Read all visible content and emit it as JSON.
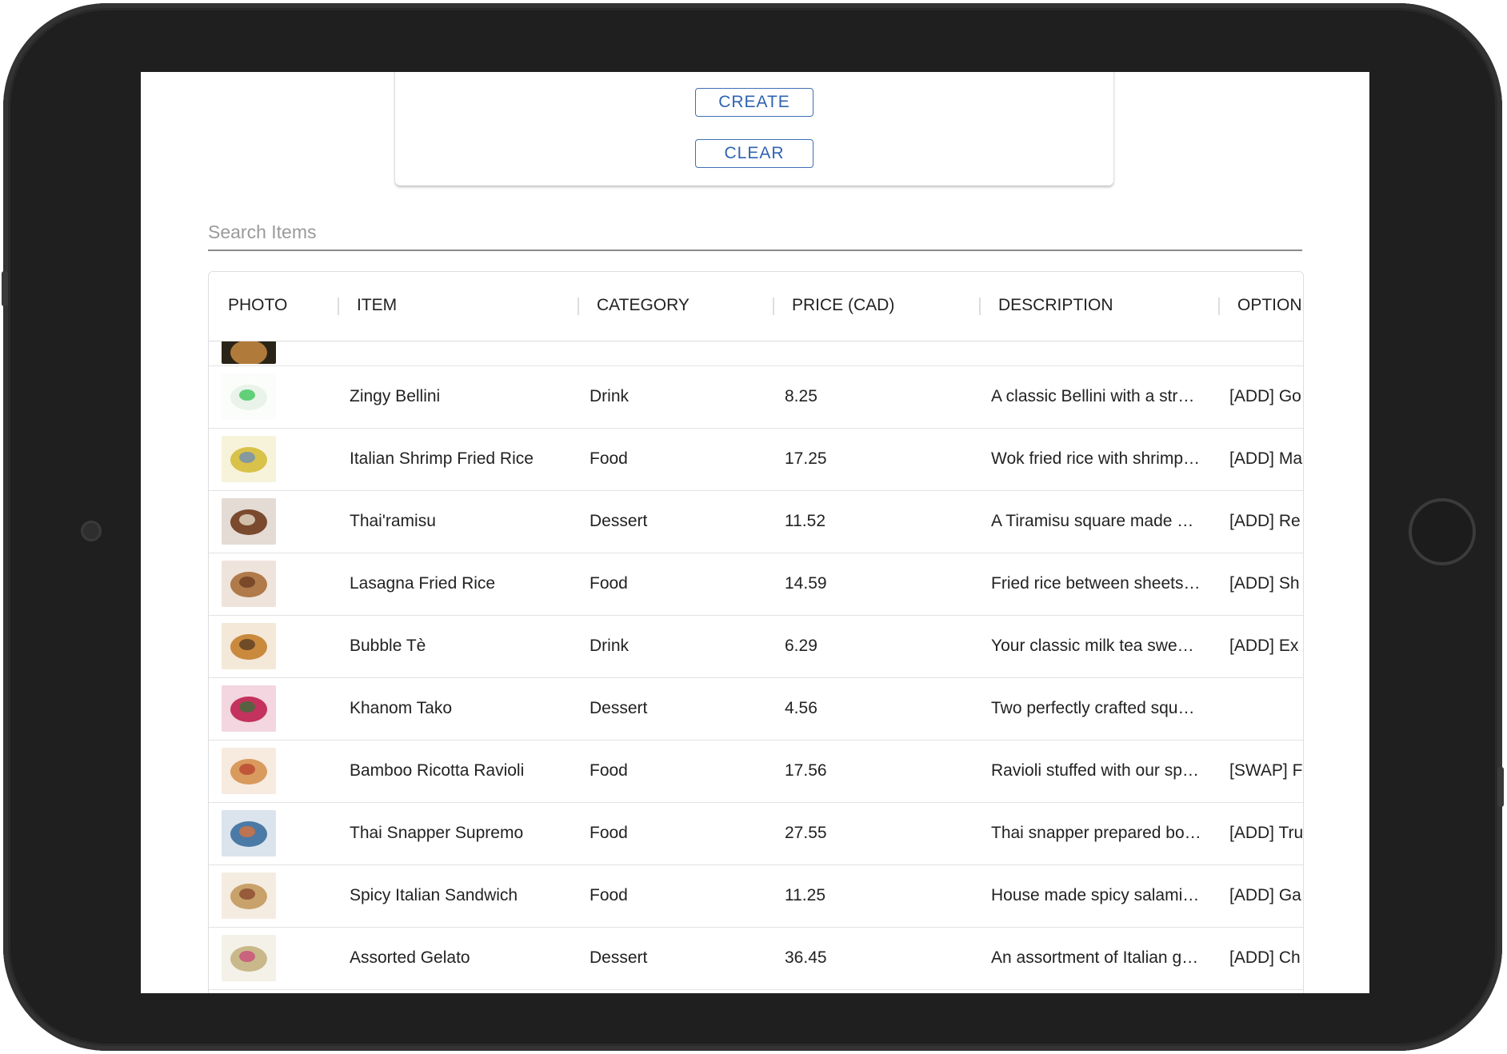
{
  "form": {
    "create_label": "CREATE",
    "clear_label": "CLEAR"
  },
  "search": {
    "placeholder": "Search Items",
    "value": ""
  },
  "table": {
    "columns": [
      "PHOTO",
      "ITEM",
      "CATEGORY",
      "PRICE (CAD)",
      "DESCRIPTION",
      "OPTION"
    ],
    "rows": [
      {
        "item": "Zingy Bellini",
        "category": "Drink",
        "price": "8.25",
        "description": "A classic Bellini with a str…",
        "option": "[ADD] Go",
        "photo_icon": "drink-photo",
        "c1": "#e9f3ea",
        "c2": "#3fc75b"
      },
      {
        "item": "Italian Shrimp Fried Rice",
        "category": "Food",
        "price": "17.25",
        "description": "Wok fried rice with shrimp…",
        "option": "[ADD] Ma",
        "photo_icon": "fried-rice-photo",
        "c1": "#d9c24a",
        "c2": "#6f8fb3"
      },
      {
        "item": "Thai'ramisu",
        "category": "Dessert",
        "price": "11.52",
        "description": "A Tiramisu square made …",
        "option": "[ADD] Re",
        "photo_icon": "tiramisu-photo",
        "c1": "#7a4a2e",
        "c2": "#e9dccb"
      },
      {
        "item": "Lasagna Fried Rice",
        "category": "Food",
        "price": "14.59",
        "description": "Fried rice between sheets…",
        "option": "[ADD] Sh",
        "photo_icon": "lasagna-photo",
        "c1": "#b07a4a",
        "c2": "#6b3d22"
      },
      {
        "item": "Bubble Tè",
        "category": "Drink",
        "price": "6.29",
        "description": "Your classic milk tea swe…",
        "option": "[ADD] Ex",
        "photo_icon": "bubble-tea-photo",
        "c1": "#c98a3e",
        "c2": "#5a3b23"
      },
      {
        "item": "Khanom Tako",
        "category": "Dessert",
        "price": "4.56",
        "description": "Two perfectly crafted squ…",
        "option": "",
        "photo_icon": "khanom-tako-photo",
        "c1": "#c4325e",
        "c2": "#3d6e3a"
      },
      {
        "item": "Bamboo Ricotta Ravioli",
        "category": "Food",
        "price": "17.56",
        "description": "Ravioli stuffed with our sp…",
        "option": "[SWAP] F",
        "photo_icon": "ravioli-photo",
        "c1": "#d99a5e",
        "c2": "#b9452e"
      },
      {
        "item": "Thai Snapper Supremo",
        "category": "Food",
        "price": "27.55",
        "description": "Thai snapper prepared bo…",
        "option": "[ADD] Tru",
        "photo_icon": "snapper-photo",
        "c1": "#4b7aa6",
        "c2": "#d8733d"
      },
      {
        "item": "Spicy Italian Sandwich",
        "category": "Food",
        "price": "11.25",
        "description": "House made spicy salami…",
        "option": "[ADD] Ga",
        "photo_icon": "sandwich-photo",
        "c1": "#c8a26a",
        "c2": "#8b4a2e"
      },
      {
        "item": "Assorted Gelato",
        "category": "Dessert",
        "price": "36.45",
        "description": "An assortment of Italian g…",
        "option": "[ADD] Ch",
        "photo_icon": "gelato-photo",
        "c1": "#c9b98a",
        "c2": "#c94d7a"
      }
    ]
  }
}
